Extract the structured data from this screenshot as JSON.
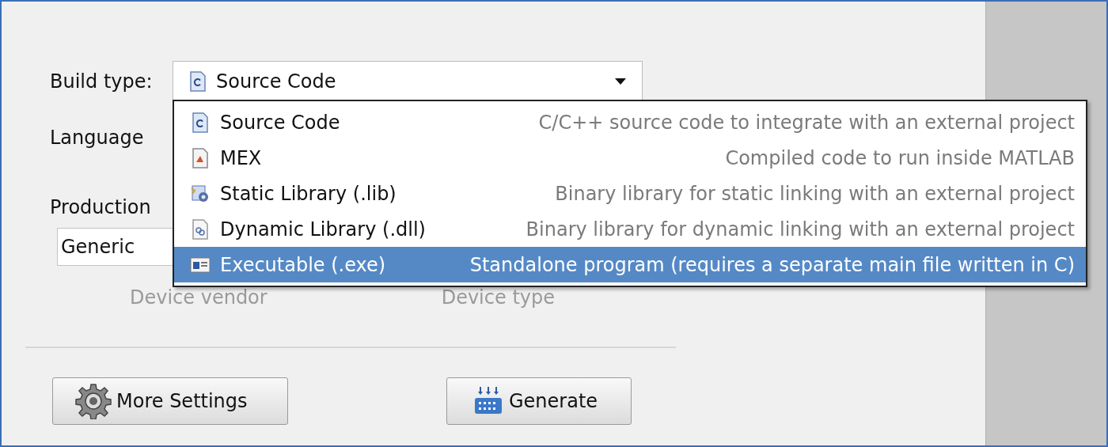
{
  "build_type": {
    "label": "Build type:",
    "value": "Source Code",
    "kind": "source"
  },
  "language": {
    "label": "Language"
  },
  "production": {
    "label": "Production",
    "vendor_value": "Generic",
    "vendor_caption": "Device vendor",
    "type_caption": "Device type"
  },
  "menu": [
    {
      "kind": "source",
      "name": "Source Code",
      "description": "C/C++ source code to integrate with an external project",
      "selected": false
    },
    {
      "kind": "mex",
      "name": "MEX",
      "description": "Compiled code to run inside MATLAB",
      "selected": false
    },
    {
      "kind": "static",
      "name": "Static Library (.lib)",
      "description": "Binary library for static linking with an external project",
      "selected": false
    },
    {
      "kind": "dynamic",
      "name": "Dynamic Library (.dll)",
      "description": "Binary library for dynamic linking with an external project",
      "selected": false
    },
    {
      "kind": "exe",
      "name": "Executable (.exe)",
      "description": "Standalone program (requires a separate main file written in C)",
      "selected": true
    }
  ],
  "buttons": [
    {
      "kind": "settings",
      "label": "More Settings"
    },
    {
      "kind": "generate",
      "label": "Generate"
    }
  ]
}
